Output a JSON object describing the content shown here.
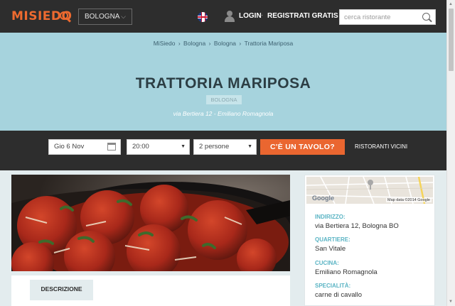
{
  "header": {
    "logo": "MISIEDO",
    "city_select": "BOLOGNA",
    "login_label": "LOGIN",
    "separator": "·",
    "register_label": "REGISTRATI GRATIS",
    "search_placeholder": "cerca ristorante"
  },
  "hero": {
    "breadcrumb": [
      "MiSiedo",
      "Bologna",
      "Bologna",
      "Trattoria Mariposa"
    ],
    "breadcrumb_separator": "›",
    "title": "TRATTORIA MARIPOSA",
    "city_tag": "BOLOGNA",
    "subtitle": "via Bertiera 12 - Emiliano Romagnola"
  },
  "booking": {
    "date_value": "Gio 6 Nov",
    "time_value": "20:00",
    "people_value": "2 persone",
    "submit_label": "C'È UN TAVOLO?",
    "nearby_label": "RISTORANTI VICINI"
  },
  "tabs": {
    "description_label": "DESCRIZIONE"
  },
  "info": {
    "map_logo": "Google",
    "map_credit": "Map data ©2014 Google",
    "rows": [
      {
        "label": "INDIRIZZO:",
        "value": "via Bertiera 12, Bologna BO"
      },
      {
        "label": "QUARTIERE:",
        "value": "San Vitale"
      },
      {
        "label": "CUCINA:",
        "value": "Emiliano Romagnola"
      },
      {
        "label": "SPECIALITÀ:",
        "value": "carne di cavallo"
      }
    ]
  },
  "colors": {
    "accent": "#ea6630",
    "header_bg": "#2d2d2d",
    "hero_bg": "#a6d3dd",
    "info_label": "#5ab4c4"
  }
}
